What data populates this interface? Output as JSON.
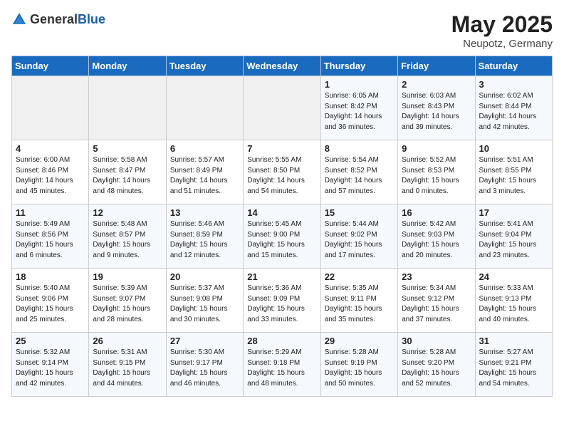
{
  "header": {
    "logo_general": "General",
    "logo_blue": "Blue",
    "month_year": "May 2025",
    "location": "Neupotz, Germany"
  },
  "days_of_week": [
    "Sunday",
    "Monday",
    "Tuesday",
    "Wednesday",
    "Thursday",
    "Friday",
    "Saturday"
  ],
  "weeks": [
    [
      {
        "day": "",
        "sunrise": "",
        "sunset": "",
        "daylight": ""
      },
      {
        "day": "",
        "sunrise": "",
        "sunset": "",
        "daylight": ""
      },
      {
        "day": "",
        "sunrise": "",
        "sunset": "",
        "daylight": ""
      },
      {
        "day": "",
        "sunrise": "",
        "sunset": "",
        "daylight": ""
      },
      {
        "day": "1",
        "sunrise": "Sunrise: 6:05 AM",
        "sunset": "Sunset: 8:42 PM",
        "daylight": "Daylight: 14 hours and 36 minutes."
      },
      {
        "day": "2",
        "sunrise": "Sunrise: 6:03 AM",
        "sunset": "Sunset: 8:43 PM",
        "daylight": "Daylight: 14 hours and 39 minutes."
      },
      {
        "day": "3",
        "sunrise": "Sunrise: 6:02 AM",
        "sunset": "Sunset: 8:44 PM",
        "daylight": "Daylight: 14 hours and 42 minutes."
      }
    ],
    [
      {
        "day": "4",
        "sunrise": "Sunrise: 6:00 AM",
        "sunset": "Sunset: 8:46 PM",
        "daylight": "Daylight: 14 hours and 45 minutes."
      },
      {
        "day": "5",
        "sunrise": "Sunrise: 5:58 AM",
        "sunset": "Sunset: 8:47 PM",
        "daylight": "Daylight: 14 hours and 48 minutes."
      },
      {
        "day": "6",
        "sunrise": "Sunrise: 5:57 AM",
        "sunset": "Sunset: 8:49 PM",
        "daylight": "Daylight: 14 hours and 51 minutes."
      },
      {
        "day": "7",
        "sunrise": "Sunrise: 5:55 AM",
        "sunset": "Sunset: 8:50 PM",
        "daylight": "Daylight: 14 hours and 54 minutes."
      },
      {
        "day": "8",
        "sunrise": "Sunrise: 5:54 AM",
        "sunset": "Sunset: 8:52 PM",
        "daylight": "Daylight: 14 hours and 57 minutes."
      },
      {
        "day": "9",
        "sunrise": "Sunrise: 5:52 AM",
        "sunset": "Sunset: 8:53 PM",
        "daylight": "Daylight: 15 hours and 0 minutes."
      },
      {
        "day": "10",
        "sunrise": "Sunrise: 5:51 AM",
        "sunset": "Sunset: 8:55 PM",
        "daylight": "Daylight: 15 hours and 3 minutes."
      }
    ],
    [
      {
        "day": "11",
        "sunrise": "Sunrise: 5:49 AM",
        "sunset": "Sunset: 8:56 PM",
        "daylight": "Daylight: 15 hours and 6 minutes."
      },
      {
        "day": "12",
        "sunrise": "Sunrise: 5:48 AM",
        "sunset": "Sunset: 8:57 PM",
        "daylight": "Daylight: 15 hours and 9 minutes."
      },
      {
        "day": "13",
        "sunrise": "Sunrise: 5:46 AM",
        "sunset": "Sunset: 8:59 PM",
        "daylight": "Daylight: 15 hours and 12 minutes."
      },
      {
        "day": "14",
        "sunrise": "Sunrise: 5:45 AM",
        "sunset": "Sunset: 9:00 PM",
        "daylight": "Daylight: 15 hours and 15 minutes."
      },
      {
        "day": "15",
        "sunrise": "Sunrise: 5:44 AM",
        "sunset": "Sunset: 9:02 PM",
        "daylight": "Daylight: 15 hours and 17 minutes."
      },
      {
        "day": "16",
        "sunrise": "Sunrise: 5:42 AM",
        "sunset": "Sunset: 9:03 PM",
        "daylight": "Daylight: 15 hours and 20 minutes."
      },
      {
        "day": "17",
        "sunrise": "Sunrise: 5:41 AM",
        "sunset": "Sunset: 9:04 PM",
        "daylight": "Daylight: 15 hours and 23 minutes."
      }
    ],
    [
      {
        "day": "18",
        "sunrise": "Sunrise: 5:40 AM",
        "sunset": "Sunset: 9:06 PM",
        "daylight": "Daylight: 15 hours and 25 minutes."
      },
      {
        "day": "19",
        "sunrise": "Sunrise: 5:39 AM",
        "sunset": "Sunset: 9:07 PM",
        "daylight": "Daylight: 15 hours and 28 minutes."
      },
      {
        "day": "20",
        "sunrise": "Sunrise: 5:37 AM",
        "sunset": "Sunset: 9:08 PM",
        "daylight": "Daylight: 15 hours and 30 minutes."
      },
      {
        "day": "21",
        "sunrise": "Sunrise: 5:36 AM",
        "sunset": "Sunset: 9:09 PM",
        "daylight": "Daylight: 15 hours and 33 minutes."
      },
      {
        "day": "22",
        "sunrise": "Sunrise: 5:35 AM",
        "sunset": "Sunset: 9:11 PM",
        "daylight": "Daylight: 15 hours and 35 minutes."
      },
      {
        "day": "23",
        "sunrise": "Sunrise: 5:34 AM",
        "sunset": "Sunset: 9:12 PM",
        "daylight": "Daylight: 15 hours and 37 minutes."
      },
      {
        "day": "24",
        "sunrise": "Sunrise: 5:33 AM",
        "sunset": "Sunset: 9:13 PM",
        "daylight": "Daylight: 15 hours and 40 minutes."
      }
    ],
    [
      {
        "day": "25",
        "sunrise": "Sunrise: 5:32 AM",
        "sunset": "Sunset: 9:14 PM",
        "daylight": "Daylight: 15 hours and 42 minutes."
      },
      {
        "day": "26",
        "sunrise": "Sunrise: 5:31 AM",
        "sunset": "Sunset: 9:15 PM",
        "daylight": "Daylight: 15 hours and 44 minutes."
      },
      {
        "day": "27",
        "sunrise": "Sunrise: 5:30 AM",
        "sunset": "Sunset: 9:17 PM",
        "daylight": "Daylight: 15 hours and 46 minutes."
      },
      {
        "day": "28",
        "sunrise": "Sunrise: 5:29 AM",
        "sunset": "Sunset: 9:18 PM",
        "daylight": "Daylight: 15 hours and 48 minutes."
      },
      {
        "day": "29",
        "sunrise": "Sunrise: 5:28 AM",
        "sunset": "Sunset: 9:19 PM",
        "daylight": "Daylight: 15 hours and 50 minutes."
      },
      {
        "day": "30",
        "sunrise": "Sunrise: 5:28 AM",
        "sunset": "Sunset: 9:20 PM",
        "daylight": "Daylight: 15 hours and 52 minutes."
      },
      {
        "day": "31",
        "sunrise": "Sunrise: 5:27 AM",
        "sunset": "Sunset: 9:21 PM",
        "daylight": "Daylight: 15 hours and 54 minutes."
      }
    ]
  ]
}
